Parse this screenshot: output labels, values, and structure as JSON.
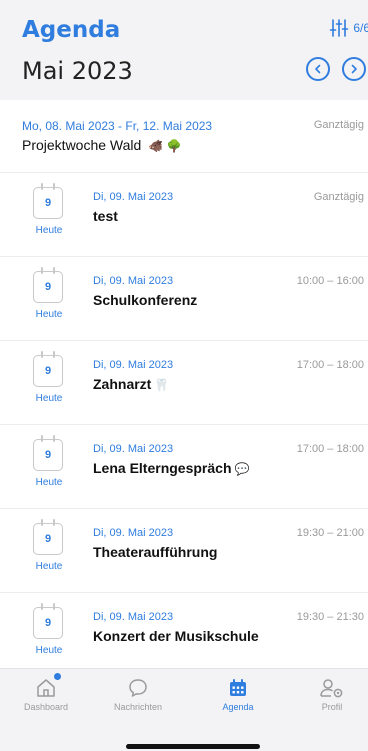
{
  "header": {
    "title": "Agenda",
    "filter_count": "6/6",
    "month": "Mai 2023"
  },
  "featured": {
    "date_range": "Mo, 08. Mai 2023 - Fr, 12. Mai 2023",
    "time": "Ganztägig",
    "name": "Projektwoche Wald",
    "emoji": "🐗 🌳"
  },
  "events": [
    {
      "cal_day": "9",
      "cal_label": "Heute",
      "date": "Di, 09. Mai 2023",
      "time": "Ganztägig",
      "name": "test",
      "emoji": ""
    },
    {
      "cal_day": "9",
      "cal_label": "Heute",
      "date": "Di, 09. Mai 2023",
      "time": "10:00 – 16:00",
      "name": "Schulkonferenz",
      "emoji": ""
    },
    {
      "cal_day": "9",
      "cal_label": "Heute",
      "date": "Di, 09. Mai 2023",
      "time": "17:00 – 18:00",
      "name": "Zahnarzt",
      "emoji": "🦷"
    },
    {
      "cal_day": "9",
      "cal_label": "Heute",
      "date": "Di, 09. Mai 2023",
      "time": "17:00 – 18:00",
      "name": "Lena Elterngespräch",
      "emoji": "💬"
    },
    {
      "cal_day": "9",
      "cal_label": "Heute",
      "date": "Di, 09. Mai 2023",
      "time": "19:30 – 21:00",
      "name": "Theateraufführung",
      "emoji": ""
    },
    {
      "cal_day": "9",
      "cal_label": "Heute",
      "date": "Di, 09. Mai 2023",
      "time": "19:30 – 21:30",
      "name": "Konzert der Musikschule",
      "emoji": ""
    }
  ],
  "tabbar": {
    "dashboard": "Dashboard",
    "messages": "Nachrichten",
    "agenda": "Agenda",
    "profile": "Profil"
  },
  "colors": {
    "accent": "#2f7dde"
  }
}
